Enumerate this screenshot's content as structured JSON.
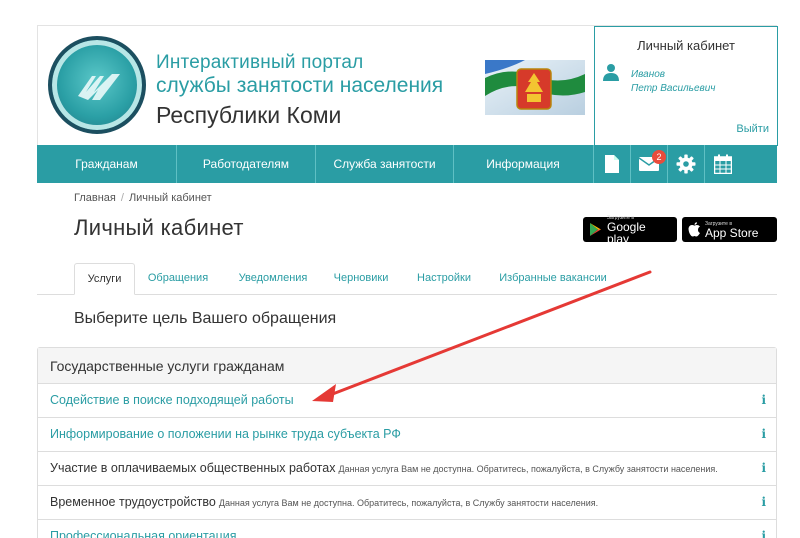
{
  "header": {
    "title_line1": "Интерактивный портал",
    "title_line2": "службы занятости населения",
    "title_line3": "Республики Коми"
  },
  "cabinet": {
    "title": "Личный кабинет",
    "surname": "Иванов",
    "name": "Петр Васильевич",
    "logout": "Выйти"
  },
  "nav": {
    "items": [
      "Гражданам",
      "Работодателям",
      "Служба занятости",
      "Информация"
    ],
    "icons": [
      "document-icon",
      "mail-icon",
      "gear-icon",
      "calendar-icon"
    ],
    "mail_badge": "2"
  },
  "breadcrumb": {
    "home": "Главная",
    "sep": "/",
    "current": "Личный кабинет"
  },
  "page_title": "Личный кабинет",
  "stores": {
    "google_small": "Загрузите в",
    "google_big": "Google play",
    "apple_small": "Загрузите в",
    "apple_big": "App Store"
  },
  "tabs": [
    "Услуги",
    "Обращения",
    "Уведомления",
    "Черновики",
    "Настройки",
    "Избранные вакансии"
  ],
  "subheading": "Выберите цель Вашего обращения",
  "panel": {
    "title": "Государственные услуги гражданам",
    "rows": [
      {
        "label": "Содействие в поиске подходящей работы",
        "note": "",
        "info": "i"
      },
      {
        "label": "Информирование о положении на рынке труда субъекта РФ",
        "note": "",
        "info": "i"
      },
      {
        "label": "Участие в оплачиваемых общественных работах",
        "note": "Данная услуга Вам не доступна. Обратитесь, пожалуйста, в Службу занятости населения.",
        "info": "i"
      },
      {
        "label": "Временное трудоустройство",
        "note": "Данная услуга Вам не доступна. Обратитесь, пожалуйста, в Службу занятости населения.",
        "info": "i"
      },
      {
        "label": "Профессиональная ориентация",
        "note": "",
        "info": "i"
      }
    ]
  },
  "colors": {
    "accent": "#2a9da4",
    "annotation_arrow": "#e53935",
    "badge": "#e74c3c"
  }
}
